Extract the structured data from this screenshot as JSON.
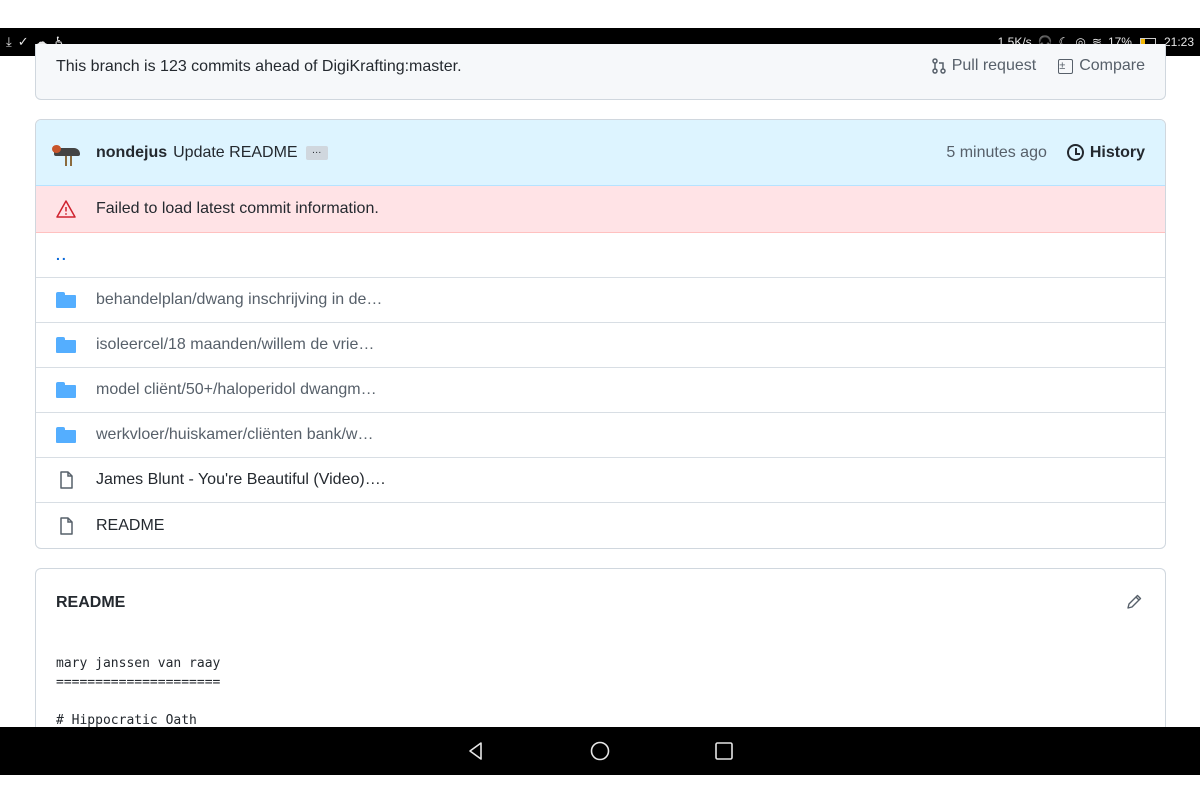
{
  "status_bar": {
    "left_icons": [
      "download-icon",
      "download-done-icon",
      "cloud-icon",
      "accessibility-icon"
    ],
    "right_text": "1,5K/s",
    "battery": "17%",
    "time": "21:23"
  },
  "branch": {
    "status_text": "This branch is 123 commits ahead of DigiKrafting:master.",
    "pull_request_label": "Pull request",
    "compare_label": "Compare"
  },
  "commit": {
    "author": "nondejus",
    "message": "Update README",
    "ellipsis": "…",
    "time": "5 minutes ago",
    "history_label": "History"
  },
  "error": {
    "message": "Failed to load latest commit information."
  },
  "files": {
    "updir": "..",
    "items": [
      {
        "type": "folder",
        "name": "behandelplan/dwang inschrijving in de…"
      },
      {
        "type": "folder",
        "name": "isoleercel/18 maanden/willem de vrie…"
      },
      {
        "type": "folder",
        "name": "model cliënt/50+/haloperidol dwangm…"
      },
      {
        "type": "folder",
        "name": "werkvloer/huiskamer/cliënten bank/w…"
      },
      {
        "type": "file",
        "name": "James Blunt - You're Beautiful (Video)…."
      },
      {
        "type": "file",
        "name": "README"
      }
    ]
  },
  "readme": {
    "title": "README",
    "line1": "mary janssen van raay",
    "line2": "=====================",
    "line3": "",
    "line4": "# Hippocratic Oath"
  },
  "colors": {
    "accent_blue": "#0969da",
    "folder_blue": "#54aeff",
    "commit_bg": "#ddf4ff",
    "error_bg": "#ffe3e6"
  }
}
